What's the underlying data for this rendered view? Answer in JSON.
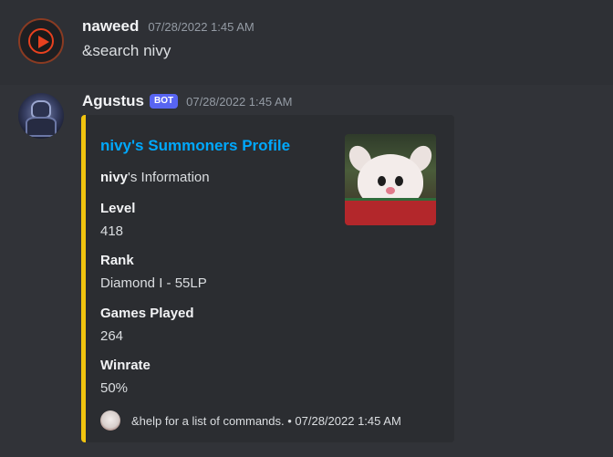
{
  "messages": [
    {
      "username": "naweed",
      "timestamp": "07/28/2022 1:45 AM",
      "content": "&search nivy",
      "avatar_icon": "play-icon"
    },
    {
      "username": "Agustus",
      "badge": "BOT",
      "timestamp": "07/28/2022 1:45 AM",
      "avatar_icon": "armored-knight-avatar",
      "embed": {
        "accent_color": "#f1c40f",
        "title": "nivy's Summoners Profile",
        "description_bold": "nivy",
        "description_rest": "'s Information",
        "fields": [
          {
            "name": "Level",
            "value": "418"
          },
          {
            "name": "Rank",
            "value": "Diamond I - 55LP"
          },
          {
            "name": "Games Played",
            "value": "264"
          },
          {
            "name": "Winrate",
            "value": "50%"
          }
        ],
        "thumbnail_icon": "poro-thumbnail",
        "footer": "&help for a list of commands. • 07/28/2022 1:45 AM",
        "footer_icon": "poro-icon"
      }
    }
  ],
  "colors": {
    "background": "#313338",
    "link": "#00a8fc",
    "bot_badge": "#5865f2"
  }
}
